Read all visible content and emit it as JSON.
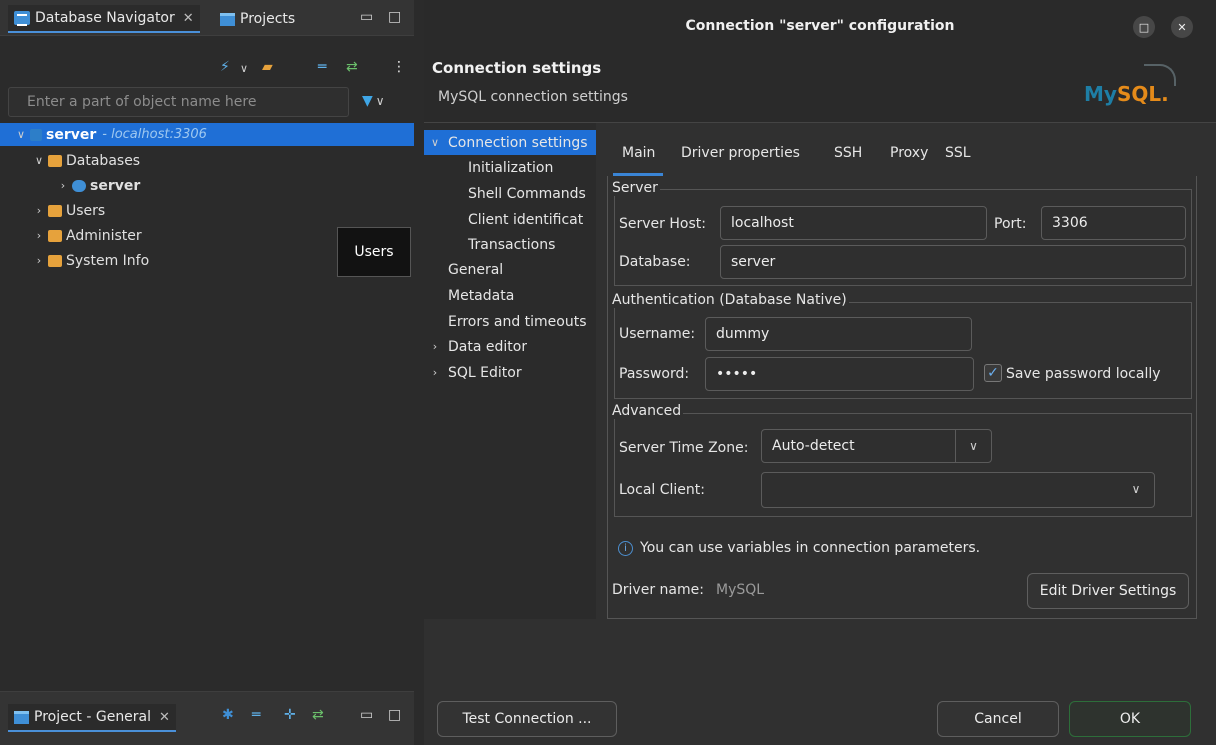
{
  "left_panel": {
    "tabs": [
      {
        "label": "Database Navigator"
      },
      {
        "label": "Projects"
      }
    ],
    "filter_placeholder": "Enter a part of object name here",
    "tree": [
      {
        "label": "server",
        "hint": "- localhost:3306"
      },
      {
        "label": "Databases"
      },
      {
        "label": "server"
      },
      {
        "label": "Users"
      },
      {
        "label": "Administer"
      },
      {
        "label": "System Info"
      }
    ],
    "tooltip": "Users",
    "bottom_tab": "Project - General"
  },
  "dialog": {
    "title": "Connection \"server\" configuration",
    "header_title": "Connection settings",
    "header_subtitle": "MySQL connection settings",
    "logo": {
      "my": "My",
      "sql": "SQL",
      "dot": "."
    },
    "nav": [
      {
        "label": "Connection settings"
      },
      {
        "label": "Initialization"
      },
      {
        "label": "Shell Commands"
      },
      {
        "label": "Client identificat"
      },
      {
        "label": "Transactions"
      },
      {
        "label": "General"
      },
      {
        "label": "Metadata"
      },
      {
        "label": "Errors and timeouts"
      },
      {
        "label": "Data editor"
      },
      {
        "label": "SQL Editor"
      }
    ],
    "tabs": [
      {
        "label": "Main"
      },
      {
        "label": "Driver properties"
      },
      {
        "label": "SSH"
      },
      {
        "label": "Proxy"
      },
      {
        "label": "SSL"
      }
    ],
    "server": {
      "group": "Server",
      "host_label": "Server Host:",
      "host_value": "localhost",
      "port_label": "Port:",
      "port_value": "3306",
      "db_label": "Database:",
      "db_value": "server"
    },
    "auth": {
      "group": "Authentication (Database Native)",
      "user_label": "Username:",
      "user_value": "dummy",
      "pass_label": "Password:",
      "pass_value": "•••••",
      "save_label": "Save password locally",
      "save_checked": true
    },
    "advanced": {
      "group": "Advanced",
      "tz_label": "Server Time Zone:",
      "tz_value": "Auto-detect",
      "client_label": "Local Client:",
      "client_value": ""
    },
    "info_text": "You can use variables in connection parameters.",
    "driver_label": "Driver name:",
    "driver_value": "MySQL",
    "edit_driver_label": "Edit Driver Settings",
    "buttons": {
      "test": "Test Connection ...",
      "cancel": "Cancel",
      "ok": "OK"
    }
  }
}
